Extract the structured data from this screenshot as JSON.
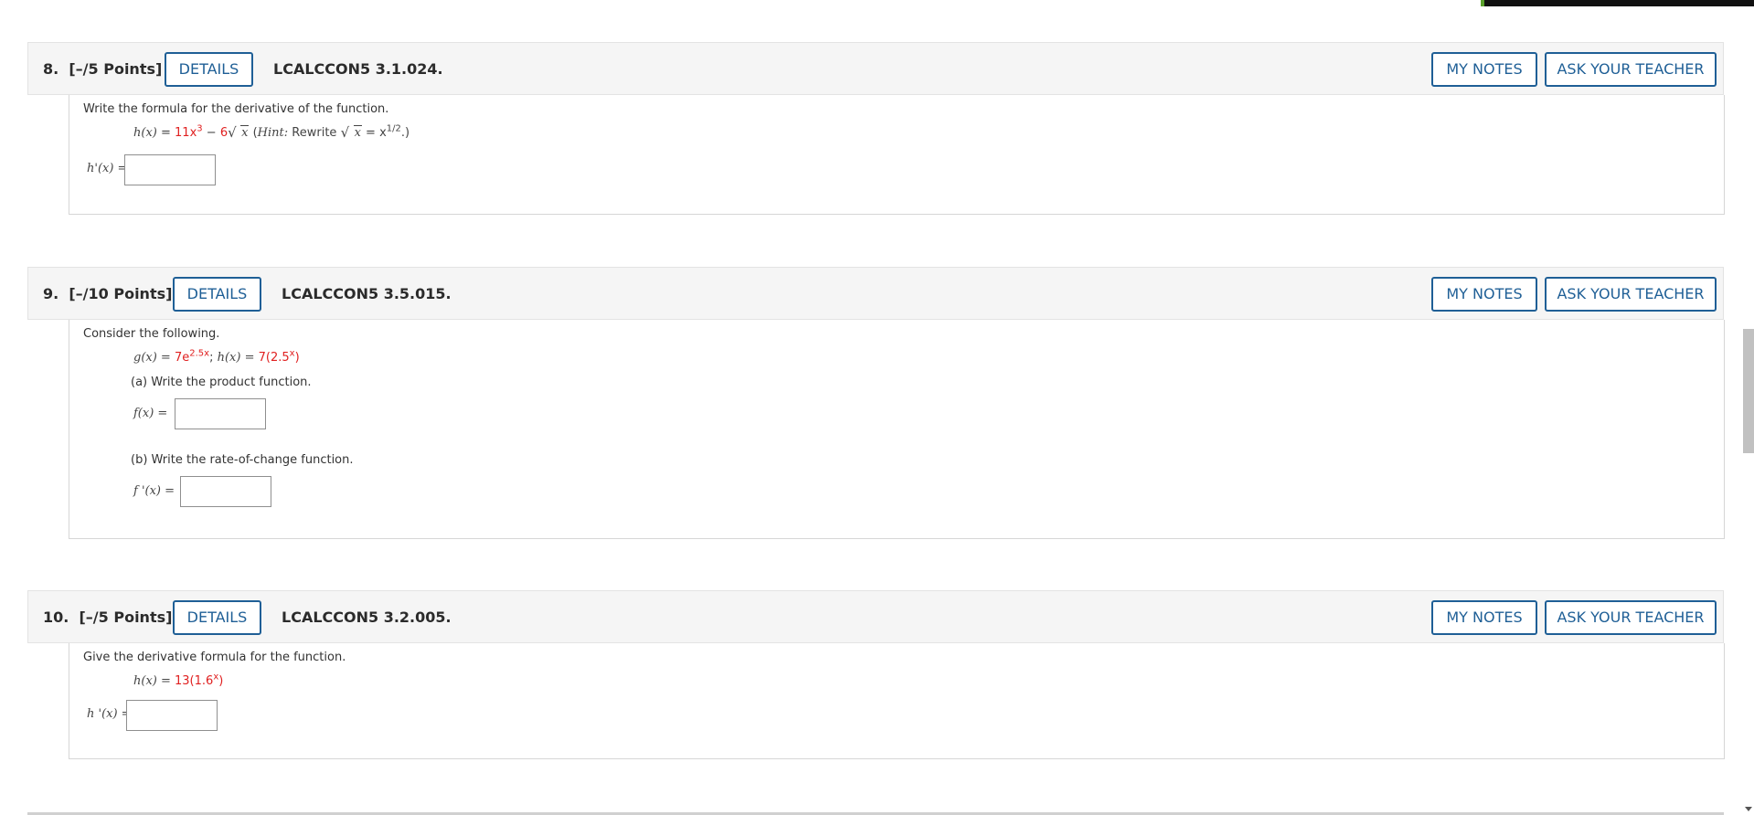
{
  "colors": {
    "accent": "#1f5f96",
    "red": "#e02020",
    "header_bg": "#f5f5f5"
  },
  "q8": {
    "number": "8.",
    "points": "[–/5 Points]",
    "details": "DETAILS",
    "code": "LCALCCON5 3.1.024.",
    "my_notes": "MY NOTES",
    "ask_teacher": "ASK YOUR TEACHER",
    "prompt": "Write the formula for the derivative of the function.",
    "fn_lhs": "h(x)",
    "fn_eq": " = ",
    "fn_coef1": "11x",
    "fn_exp1": "3",
    "fn_minus": " − ",
    "fn_coef2": "6",
    "fn_sqrt": "x",
    "hint_open": "  (",
    "hint_word": "Hint:",
    "hint_rewrite": " Rewrite ",
    "hint_sqrt": "x",
    "hint_eq": " = x",
    "hint_exp": "1/2",
    "hint_close": ".)",
    "answer_label": "h'(x) =",
    "answer_value": ""
  },
  "q9": {
    "number": "9.",
    "points": "[–/10 Points]",
    "details": "DETAILS",
    "code": "LCALCCON5 3.5.015.",
    "my_notes": "MY NOTES",
    "ask_teacher": "ASK YOUR TEACHER",
    "prompt": "Consider the following.",
    "g_lhs": "g(x) = ",
    "g_coef": "7e",
    "g_exp": "2.5x",
    "sep": "; ",
    "h_lhs": "h(x) = ",
    "h_rhs": "7(2.5",
    "h_exp": "x",
    "h_close": ")",
    "part_a": "(a) Write the product function.",
    "a_label": "f(x) =",
    "a_value": "",
    "part_b": "(b) Write the rate-of-change function.",
    "b_label": "f '(x) =",
    "b_value": ""
  },
  "q10": {
    "number": "10.",
    "points": "[–/5 Points]",
    "details": "DETAILS",
    "code": "LCALCCON5 3.2.005.",
    "my_notes": "MY NOTES",
    "ask_teacher": "ASK YOUR TEACHER",
    "prompt": "Give the derivative formula for the function.",
    "fn_lhs": "h(x) = ",
    "fn_rhs": "13(1.6",
    "fn_exp": "x",
    "fn_close": ")",
    "answer_label": "h '(x) =",
    "answer_value": ""
  }
}
